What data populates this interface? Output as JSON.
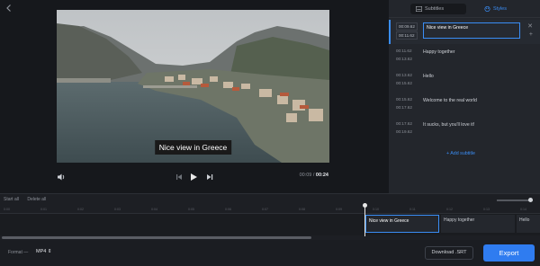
{
  "player": {
    "caption": "Nice view in Greece",
    "current_time": "00:09",
    "separator": "/",
    "total_time": "00:24"
  },
  "panel": {
    "tabs": [
      {
        "label": "Subtitles",
        "icon": "subtitles-icon"
      },
      {
        "label": "Styles",
        "icon": "palette-icon"
      }
    ],
    "rows": [
      {
        "start": "00:09.62",
        "end": "00:11.62",
        "text": "Nice view in Greece"
      },
      {
        "start": "00:11.62",
        "end": "00:13.62",
        "text": "Happy together"
      },
      {
        "start": "00:13.62",
        "end": "00:15.62",
        "text": "Hello"
      },
      {
        "start": "00:15.62",
        "end": "00:17.62",
        "text": "Welcome to the real world"
      },
      {
        "start": "00:17.62",
        "end": "00:19.62",
        "text": "It sucks,  but you'll love it!"
      }
    ],
    "add_label": "+ Add subtitle"
  },
  "timeline": {
    "start_all": "Start all",
    "delete_all": "Delete all",
    "ticks": [
      "0:00",
      "0:01",
      "0:02",
      "0:03",
      "0:04",
      "0:05",
      "0:06",
      "0:07",
      "0:08",
      "0:09",
      "0:10",
      "0:11",
      "0:12",
      "0:13",
      "0:14"
    ],
    "segments": [
      "Nice view in Greece",
      "Happy together",
      "Hello"
    ]
  },
  "footer": {
    "format_label": "Format",
    "format_value": "MP4",
    "download_label": "Download .SRT",
    "export_label": "Export"
  },
  "colors": {
    "accent": "#2f7cf0",
    "background": "#1b1d22"
  }
}
